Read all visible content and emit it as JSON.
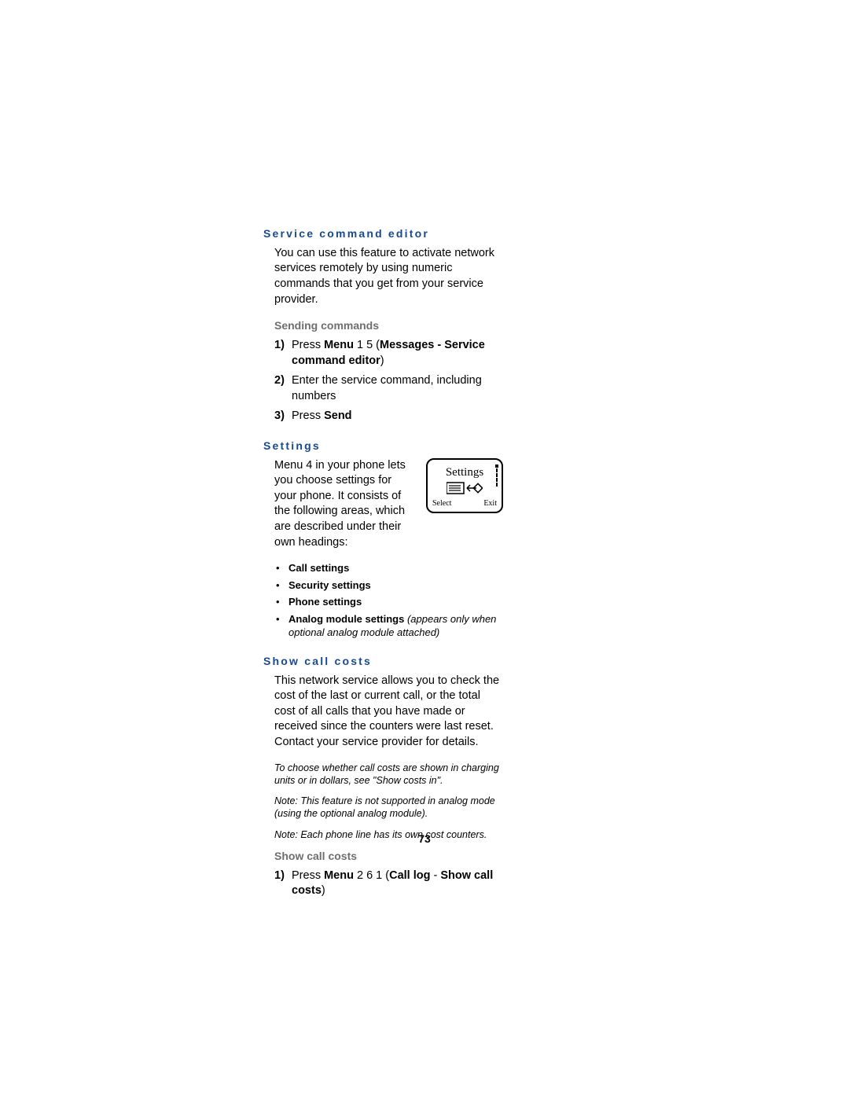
{
  "section1": {
    "heading": "Service command editor",
    "para": "You can use this feature to activate network services remotely by using numeric commands that you get from your service provider.",
    "sub": "Sending commands",
    "steps": [
      {
        "n": "1)",
        "pre": "Press ",
        "b1": "Menu",
        "mid": " 1 5 (",
        "b2": "Messages - Service command editor",
        "post": ")"
      },
      {
        "n": "2)",
        "text": "Enter the service command, including numbers"
      },
      {
        "n": "3)",
        "pre": "Press ",
        "b1": "Send"
      }
    ]
  },
  "section2": {
    "heading": "Settings",
    "para": "Menu 4 in your phone lets you choose settings for your phone. It consists of the following areas, which are described under their own headings:",
    "screen": {
      "title": "Settings",
      "left": "Select",
      "right": "Exit"
    },
    "bullets": [
      {
        "bold": "Call settings"
      },
      {
        "bold": "Security settings"
      },
      {
        "bold": "Phone settings"
      },
      {
        "bold": "Analog module settings",
        "italic": " (appears only when optional analog module attached)"
      }
    ]
  },
  "section3": {
    "heading": "Show call costs",
    "para": "This network service allows you to check the cost of the last or current call, or the total cost of all calls that you have made or received since the counters were last reset. Contact your service provider for details.",
    "note1": "To choose whether call costs are shown in charging units or in dollars, see \"Show costs in\".",
    "note2": "Note: This feature is not supported in analog mode (using the optional analog module).",
    "note3": "Note: Each phone line has its own cost counters.",
    "sub": "Show call costs",
    "step": {
      "n": "1)",
      "pre": "Press ",
      "b1": "Menu",
      "mid": " 2 6 1 (",
      "b2": "Call log",
      "dash": " - ",
      "b3": "Show call costs",
      "post": ")"
    }
  },
  "pagenum": "73"
}
